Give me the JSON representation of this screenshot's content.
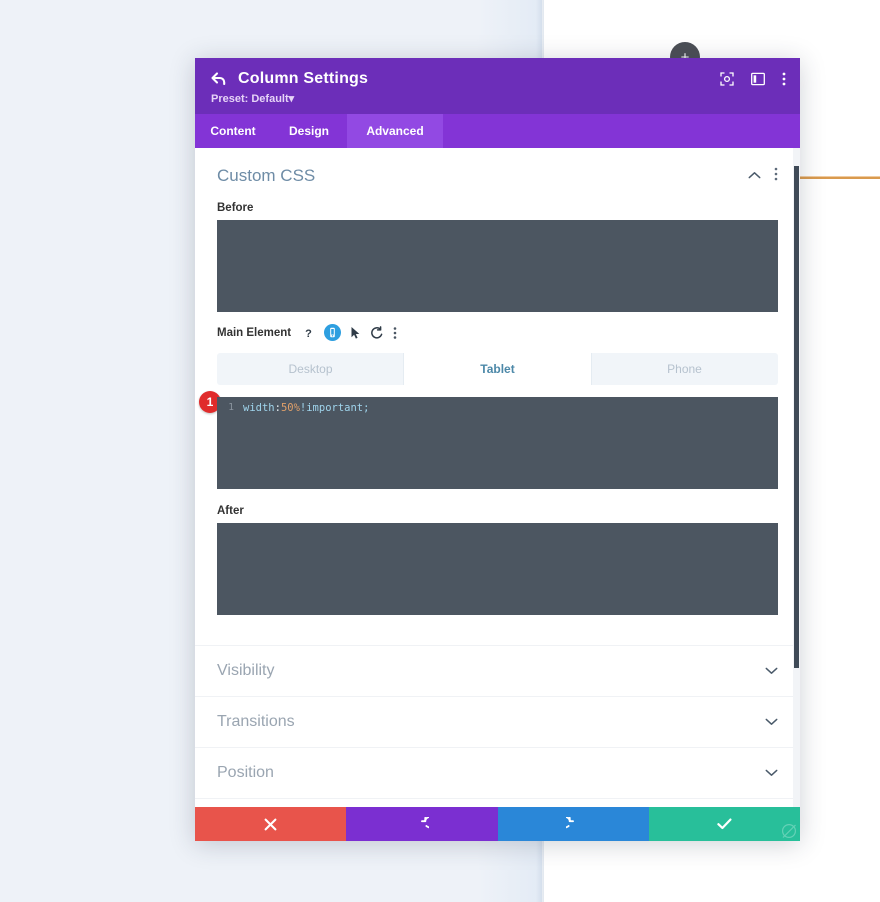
{
  "background": {
    "canvas_color": "#eef2f8",
    "page_color": "#ffffff",
    "divider_color": "#d99a4e",
    "add_button_label": "+"
  },
  "modal": {
    "header": {
      "back_icon": "back-arrow-icon",
      "title": "Column Settings",
      "preset_label": "Preset: Default",
      "preset_caret": "▾",
      "icons": [
        {
          "name": "focus-target-icon"
        },
        {
          "name": "layout-columns-icon"
        },
        {
          "name": "overflow-menu-icon"
        }
      ],
      "bg_color": "#6c2eb9"
    },
    "tabs": [
      {
        "label": "Content",
        "active": false
      },
      {
        "label": "Design",
        "active": false
      },
      {
        "label": "Advanced",
        "active": true
      }
    ],
    "section": {
      "title": "Custom CSS",
      "collapse_icon": "chevron-up-icon",
      "menu_icon": "overflow-menu-icon",
      "title_color": "#6e8ca6"
    },
    "fields": {
      "before_label": "Before",
      "before_value": "",
      "before_placeholder": "",
      "main_element_label": "Main Element",
      "main_element_icons": [
        {
          "name": "help-icon",
          "glyph": "?"
        },
        {
          "name": "responsive-tablet-icon",
          "active": true
        },
        {
          "name": "hover-cursor-icon"
        },
        {
          "name": "reset-undo-icon"
        },
        {
          "name": "overflow-menu-icon"
        }
      ],
      "main_element_value": "width: 50% !important;",
      "code_tokens": {
        "property": "width",
        "colon": ": ",
        "value": "50%",
        "space": " ",
        "important": "!important",
        "semicolon": ";"
      },
      "line_number": "1",
      "step_badge": "1",
      "after_label": "After",
      "after_value": ""
    },
    "responsive_tabs": [
      {
        "label": "Desktop",
        "active": false
      },
      {
        "label": "Tablet",
        "active": true
      },
      {
        "label": "Phone",
        "active": false
      }
    ],
    "accordions": [
      {
        "label": "Visibility",
        "icon": "chevron-down-icon"
      },
      {
        "label": "Transitions",
        "icon": "chevron-down-icon"
      },
      {
        "label": "Position",
        "icon": "chevron-down-icon"
      }
    ],
    "footer_buttons": [
      {
        "name": "cancel-button",
        "icon": "close-x-icon",
        "color": "#e8544b"
      },
      {
        "name": "undo-button",
        "icon": "undo-icon",
        "color": "#7b2fd1"
      },
      {
        "name": "redo-button",
        "icon": "redo-icon",
        "color": "#2a87d8"
      },
      {
        "name": "save-button",
        "icon": "checkmark-icon",
        "color": "#28bf9a"
      }
    ],
    "resize_handle": "resize-grip-icon",
    "scrollbar": {
      "name": "vertical-scrollbar"
    }
  }
}
